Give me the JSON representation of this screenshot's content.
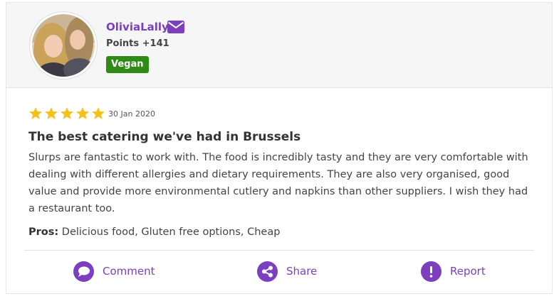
{
  "user": {
    "name": "OliviaLally",
    "points": "Points +141",
    "badge": "Vegan"
  },
  "review": {
    "rating": 5,
    "rating_max": 5,
    "date": "30 Jan 2020",
    "title": "The best catering we've had in Brussels",
    "body": "Slurps are fantastic to work with. The food is incredibly tasty and they are very comfortable with dealing with different allergies and dietary requirements. They are also very organised, good value and provide more environmental cutlery and napkins than other suppliers. I wish they had a restaurant too.",
    "pros_label": "Pros:",
    "pros_value": " Delicious food, Gluten free options, Cheap"
  },
  "actions": {
    "comment": "Comment",
    "share": "Share",
    "report": "Report"
  },
  "icons": {
    "mail": "envelope-icon",
    "comment": "comment-bubble-icon",
    "share": "share-icon",
    "report": "exclamation-icon",
    "star": "star-icon"
  },
  "colors": {
    "accent": "#7b3fbf",
    "badge": "#2f8a16",
    "star": "#f6c21a",
    "header_bg": "#f6f6f6"
  }
}
